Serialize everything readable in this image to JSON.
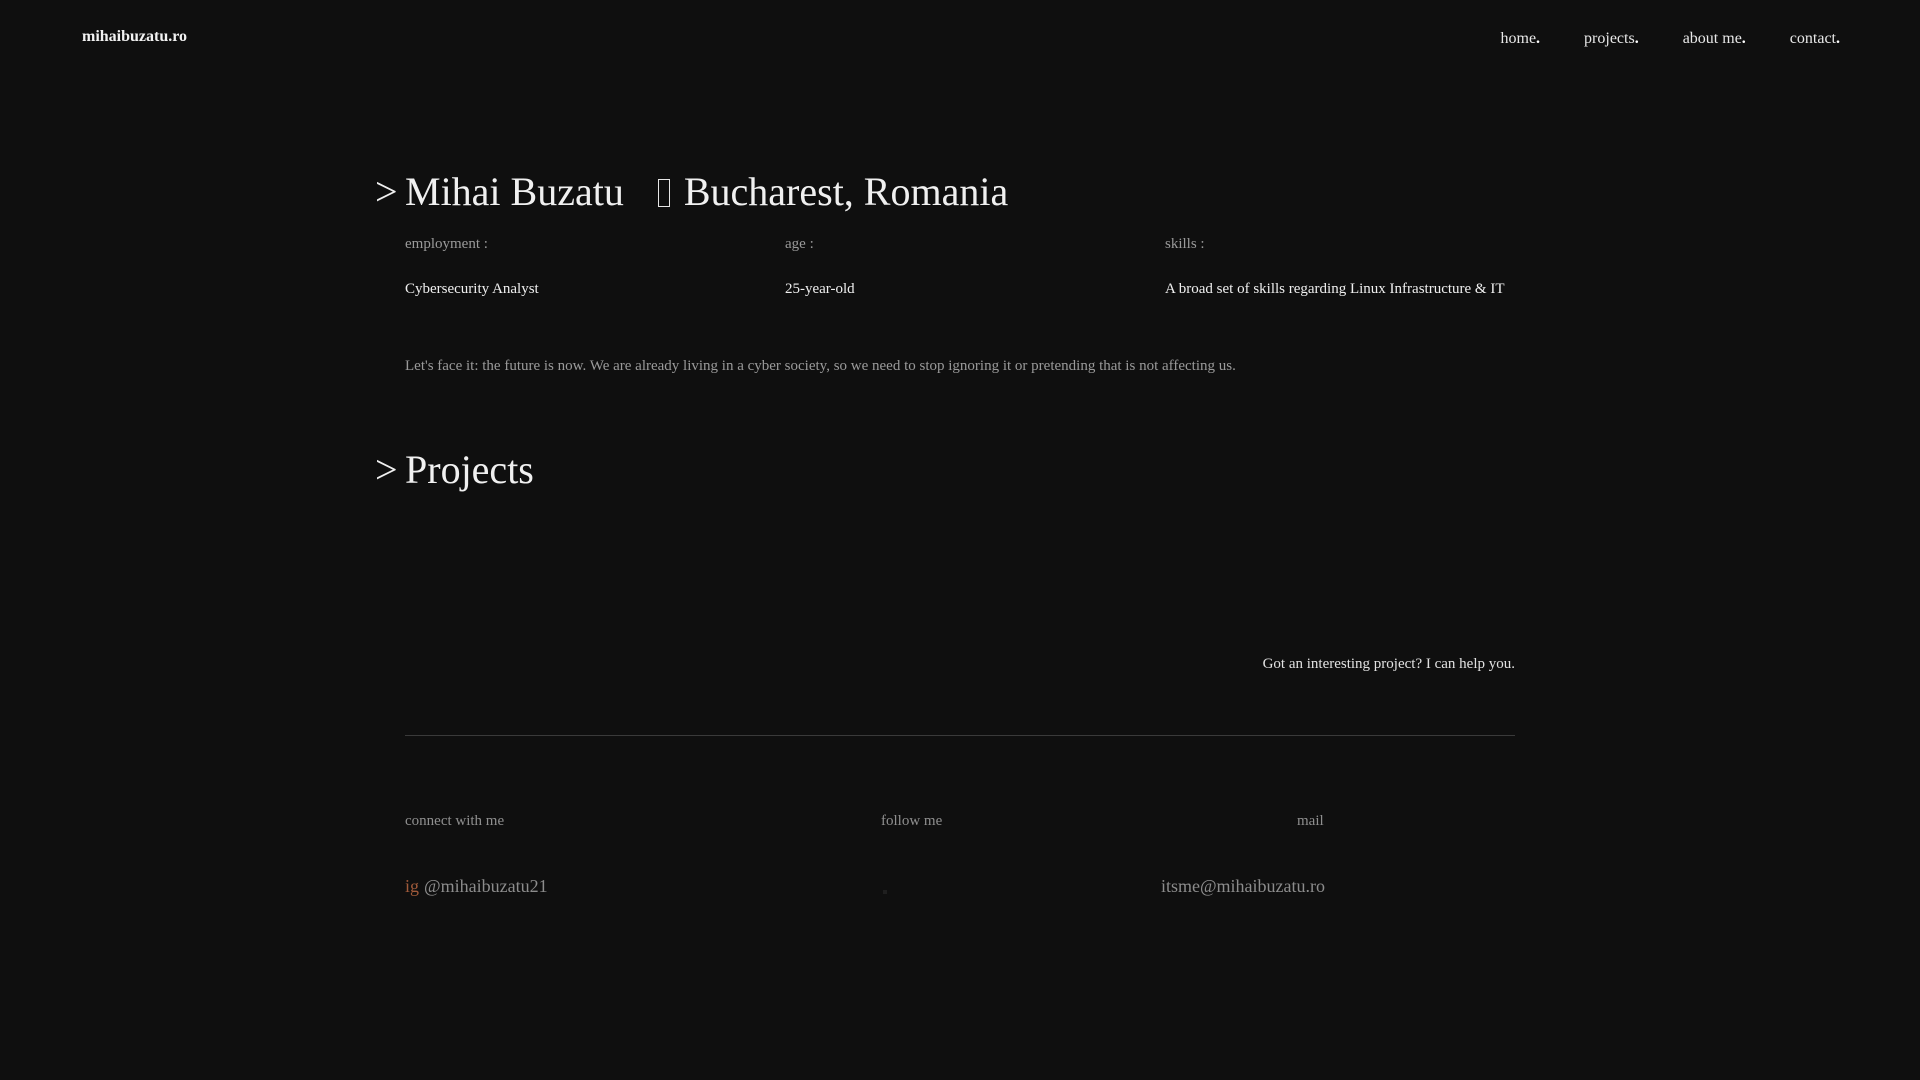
{
  "header": {
    "brand": "mihaibuzatu.ro",
    "nav": [
      {
        "label": "home",
        "dot": "."
      },
      {
        "label": "projects",
        "dot": "."
      },
      {
        "label": "about me",
        "dot": "."
      },
      {
        "label": "contact",
        "dot": "."
      }
    ]
  },
  "hero": {
    "arrow": ">",
    "name": "Mihai Buzatu",
    "location_icon": "location-pin-icon",
    "location": "Bucharest, Romania"
  },
  "info": {
    "employment_label": "employment :",
    "employment_value": "Cybersecurity Analyst",
    "age_label": "age :",
    "age_value": "25-year-old",
    "skills_label": "skills :",
    "skills_value": "A broad set of skills regarding Linux Infrastructure & IT"
  },
  "quote": "Let's face it: the future is now. We are already living in a cyber society, so we need to stop ignoring it or pretending that is not affecting us.",
  "projects": {
    "arrow": ">",
    "title": "Projects",
    "cta": "Got an interesting project? I can help you."
  },
  "footer": {
    "connect_label": "connect with me",
    "follow_label": "follow me",
    "mail_label": "mail",
    "ig_tag": "ig",
    "ig_handle": "@mihaibuzatu21",
    "email": "itsme@mihaibuzatu.ro"
  },
  "colors": {
    "background": "#0f0f0f",
    "accent": "#a05a3a"
  }
}
